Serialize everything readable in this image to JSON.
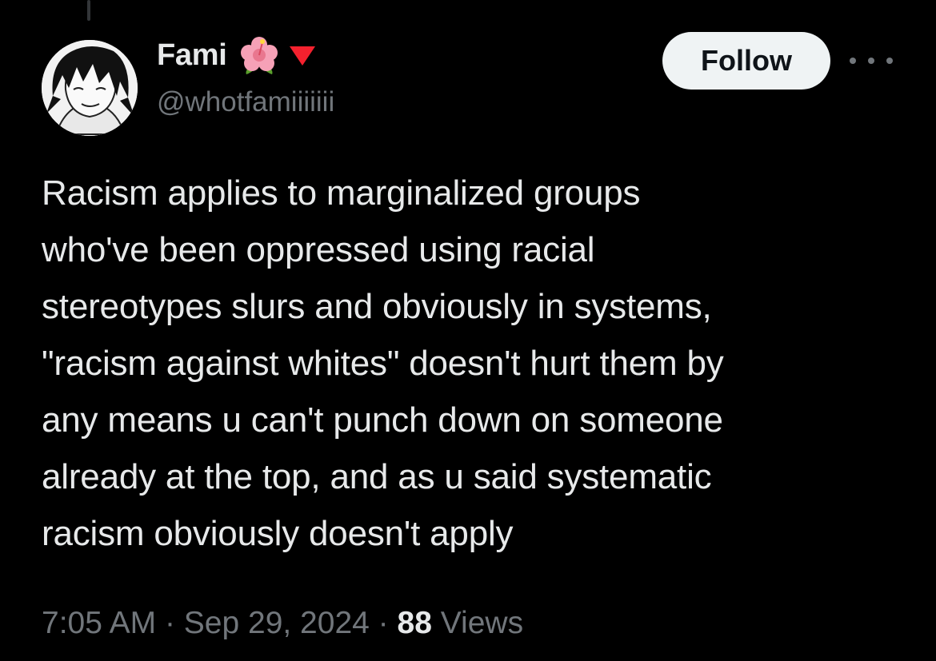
{
  "tweet": {
    "author": {
      "display_name": "Fami",
      "handle": "@whotfamiiiiiii",
      "badges": [
        "hibiscus-icon",
        "red-triangle-down-icon"
      ]
    },
    "follow_label": "Follow",
    "more_icon": "more-horizontal-icon",
    "text": "Racism applies to marginalized groups\nwho've been oppressed using racial\nstereotypes slurs and obviously in systems,\n\"racism against whites\" doesn't hurt them by\nany means u can't punch down on someone\nalready at the top, and as u said systematic\nracism obviously doesn't apply",
    "time": "7:05 AM",
    "separator": "·",
    "date": "Sep 29, 2024",
    "views_count": "88",
    "views_label": "Views"
  },
  "colors": {
    "background": "#000000",
    "primary_text": "#e7e9ea",
    "secondary_text": "#71767b",
    "follow_button_bg": "#eff3f4",
    "follow_button_text": "#0f1419",
    "triangle_badge": "#f4212e"
  }
}
